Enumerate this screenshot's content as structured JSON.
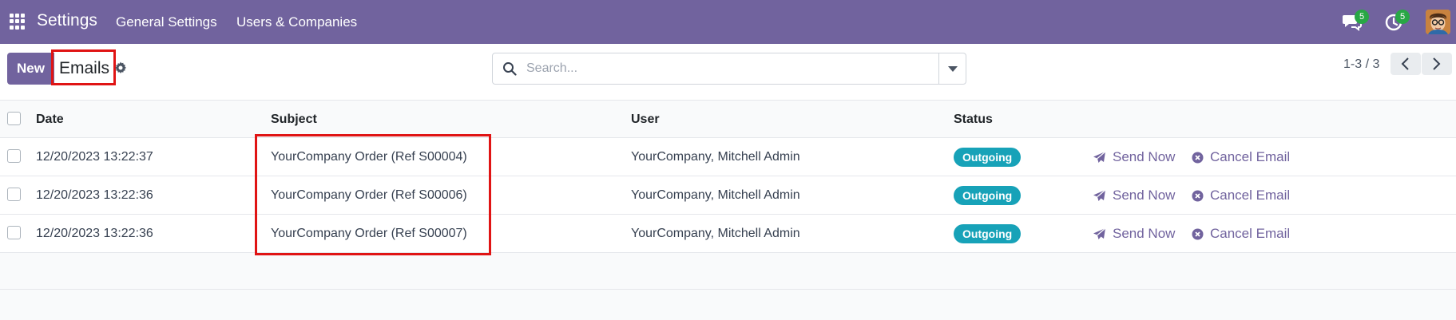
{
  "navbar": {
    "app_name": "Settings",
    "menu": [
      "General Settings",
      "Users & Companies"
    ],
    "chat_count": "5",
    "activity_count": "5",
    "icons": [
      "apps-grid-icon",
      "chat-icon",
      "clock-icon",
      "avatar"
    ]
  },
  "control": {
    "new_label": "New",
    "breadcrumb": "Emails",
    "search_placeholder": "Search...",
    "pager": "1-3 / 3"
  },
  "table": {
    "headers": [
      "Date",
      "Subject",
      "User",
      "Status"
    ],
    "rows": [
      {
        "date": "12/20/2023 13:22:37",
        "subject": "YourCompany Order (Ref S00004)",
        "user": "YourCompany, Mitchell Admin",
        "status": "Outgoing",
        "send": "Send Now",
        "cancel": "Cancel Email"
      },
      {
        "date": "12/20/2023 13:22:36",
        "subject": "YourCompany Order (Ref S00006)",
        "user": "YourCompany, Mitchell Admin",
        "status": "Outgoing",
        "send": "Send Now",
        "cancel": "Cancel Email"
      },
      {
        "date": "12/20/2023 13:22:36",
        "subject": "YourCompany Order (Ref S00007)",
        "user": "YourCompany, Mitchell Admin",
        "status": "Outgoing",
        "send": "Send Now",
        "cancel": "Cancel Email"
      }
    ]
  },
  "colors": {
    "brand": "#71639e",
    "status": "#17a2b8",
    "highlight": "#e01414",
    "badge": "#28a745"
  }
}
